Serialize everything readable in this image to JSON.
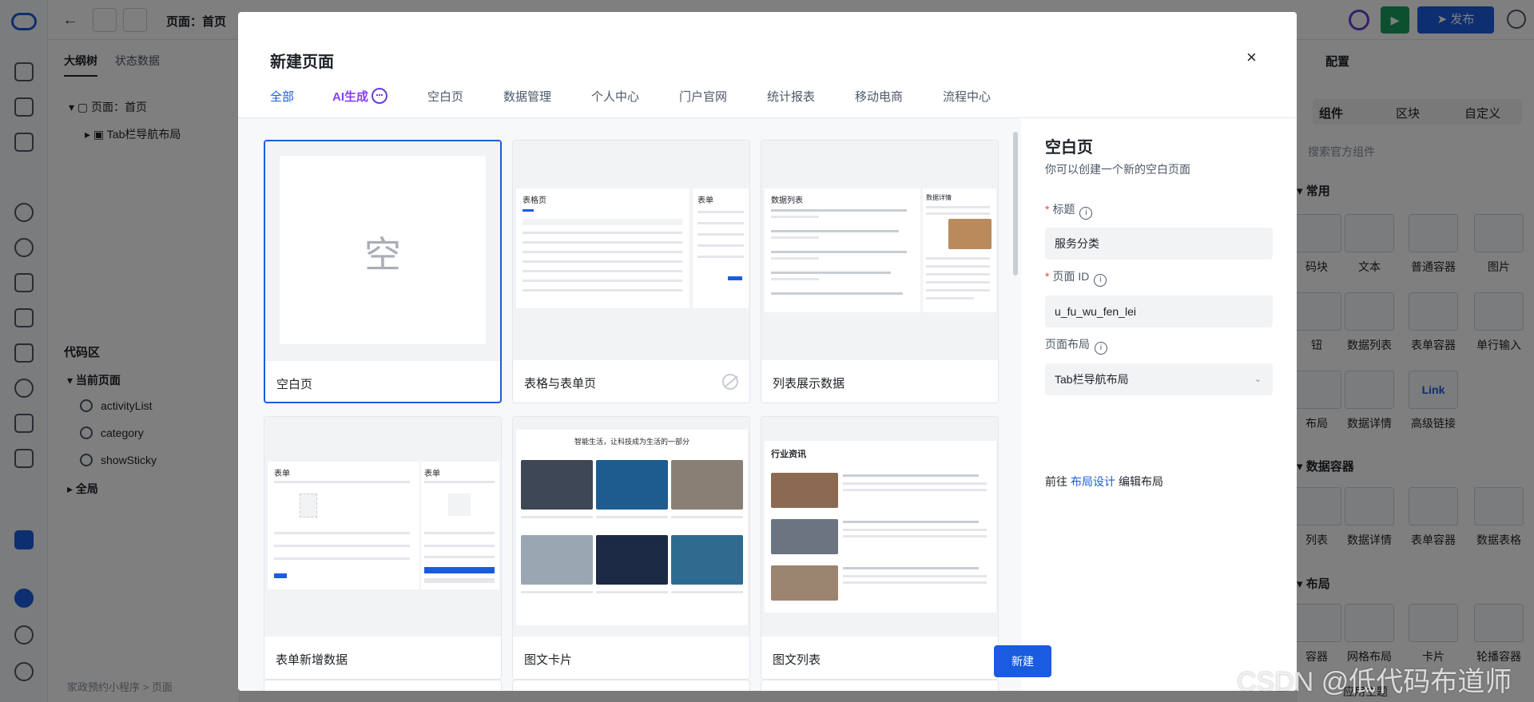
{
  "app": {
    "page_title": "页面：首页",
    "publish_label": "发布",
    "left_tabs": [
      "大纲树",
      "状态数据"
    ],
    "outline": [
      "页面：首页",
      "Tab栏导航布局"
    ],
    "code_section": "代码区",
    "current_page": "当前页面",
    "code_items": [
      "activityList",
      "category",
      "showSticky"
    ],
    "global": "全局",
    "breadcrumb": "家政预约小程序  >  页面",
    "right_title": "配置",
    "right_tabs": [
      "组件",
      "区块",
      "自定义"
    ],
    "search_placeholder": "搜索官方组件",
    "group_common": "常用",
    "group_data": "数据容器",
    "group_layout": "布局",
    "comps_row1": [
      "码块",
      "文本",
      "普通容器",
      "图片"
    ],
    "comps_row2": [
      "钮",
      "数据列表",
      "表单容器",
      "单行输入"
    ],
    "comps_row3": [
      "布局",
      "数据详情",
      "高级链接"
    ],
    "comps_row4": [
      "列表",
      "数据详情",
      "表单容器",
      "数据表格"
    ],
    "comps_row5": [
      "容器",
      "网格布局",
      "卡片",
      "轮播容器"
    ],
    "link_text": "Link",
    "footer_theme": "应用主题"
  },
  "modal": {
    "title": "新建页面",
    "close": "×",
    "tabs": [
      "全部",
      "AI生成",
      "空白页",
      "数据管理",
      "个人中心",
      "门户官网",
      "统计报表",
      "移动电商",
      "流程中心"
    ],
    "active_tab": "全部",
    "templates": [
      {
        "label": "空白页",
        "placeholder": "空",
        "selected": true
      },
      {
        "label": "表格与表单页"
      },
      {
        "label": "列表展示数据"
      },
      {
        "label": "表单新增数据"
      },
      {
        "label": "图文卡片"
      },
      {
        "label": "图文列表"
      }
    ],
    "preview_text": {
      "table_page": "表格页",
      "form": "表单",
      "list_title": "数据列表",
      "detail_title": "数据详情",
      "form_page": "表单",
      "card_headline": "智能生活，让科技成为生活的一部分",
      "news_title": "行业资讯"
    },
    "detail": {
      "title": "空白页",
      "subtitle": "你可以创建一个新的空白页面",
      "title_label": "标题",
      "title_value": "服务分类",
      "id_label": "页面 ID",
      "id_value": "u_fu_wu_fen_lei",
      "layout_label": "页面布局",
      "layout_value": "Tab栏导航布局",
      "goto_prefix": "前往",
      "goto_link": "布局设计",
      "goto_suffix": "编辑布局",
      "create_label": "新建"
    }
  },
  "watermark": "CSDN @低代码布道师",
  "colors": {
    "primary": "#1a5ce0",
    "ai": "#8a3ffc",
    "run": "#19a05e",
    "required": "#f53f3f"
  }
}
